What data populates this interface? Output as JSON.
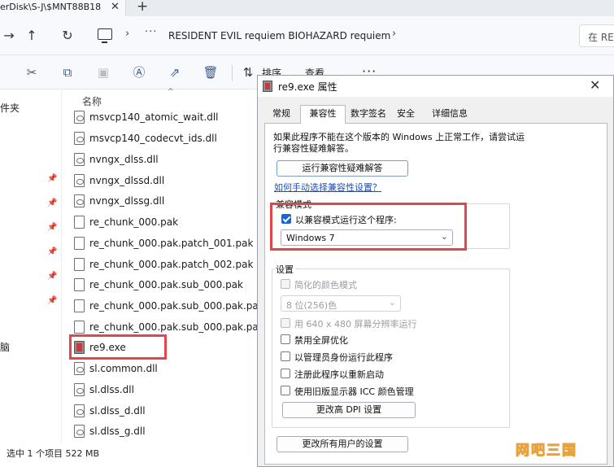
{
  "explorer": {
    "tab_title": "erDisk\\S-J\\$MNT88B18",
    "tab_close": "✕",
    "tab_new": "+",
    "breadcrumb_more": "···",
    "breadcrumb_folder": "RESIDENT EVIL requiem BIOHAZARD requiem",
    "search_placeholder": "在 RE",
    "toolbar": {
      "sort_label": "排序",
      "view_label": "查看",
      "more_label": "···"
    },
    "nav_items": [
      "件夹",
      "脑"
    ],
    "column_name": "名称",
    "files": [
      {
        "name": "msvcp140_atomic_wait.dll",
        "type": "dll"
      },
      {
        "name": "msvcp140_codecvt_ids.dll",
        "type": "dll"
      },
      {
        "name": "nvngx_dlss.dll",
        "type": "dll"
      },
      {
        "name": "nvngx_dlssd.dll",
        "type": "dll"
      },
      {
        "name": "nvngx_dlssg.dll",
        "type": "dll"
      },
      {
        "name": "re_chunk_000.pak",
        "type": "file"
      },
      {
        "name": "re_chunk_000.pak.patch_001.pak",
        "type": "file"
      },
      {
        "name": "re_chunk_000.pak.patch_002.pak",
        "type": "file"
      },
      {
        "name": "re_chunk_000.pak.sub_000.pak",
        "type": "file"
      },
      {
        "name": "re_chunk_000.pak.sub_000.pak.patch_",
        "type": "file"
      },
      {
        "name": "re_chunk_000.pak.sub_000.pak.patch_",
        "type": "file"
      },
      {
        "name": "re9.exe",
        "type": "exe"
      },
      {
        "name": "sl.common.dll",
        "type": "dll"
      },
      {
        "name": "sl.dlss.dll",
        "type": "dll"
      },
      {
        "name": "sl.dlss_d.dll",
        "type": "dll"
      },
      {
        "name": "sl.dlss_g.dll",
        "type": "dll"
      }
    ],
    "status": "选中 1 个项目  522 MB"
  },
  "dialog": {
    "title": "re9.exe 属性",
    "close": "✕",
    "tabs": [
      {
        "label": "常规",
        "active": false
      },
      {
        "label": "兼容性",
        "active": true
      },
      {
        "label": "数字签名",
        "active": false
      },
      {
        "label": "安全",
        "active": false
      },
      {
        "label": "详细信息",
        "active": false
      }
    ],
    "description": "如果此程序不能在这个版本的 Windows 上正常工作，请尝试运行兼容性疑难解答。",
    "run_troubleshooter": "运行兼容性疑难解答",
    "manual_link": "如何手动选择兼容性设置？",
    "compat_mode": {
      "group_title": "兼容模式",
      "checkbox_label": "以兼容模式运行这个程序:",
      "checked": true,
      "selected_os": "Windows 7"
    },
    "settings": {
      "group_title": "设置",
      "reduced_color_label": "简化的颜色模式",
      "color_depth": "8 位(256)色",
      "resolution_640_label": "用 640 x 480 屏幕分辨率运行",
      "disable_fullscreen_opt": "禁用全屏优化",
      "run_as_admin": "以管理员身份运行此程序",
      "register_restart": "注册此程序以重新启动",
      "legacy_icc": "使用旧版显示器 ICC 颜色管理",
      "high_dpi_button": "更改高 DPI 设置"
    },
    "all_users_button": "更改所有用户的设置"
  },
  "watermark": "网吧三国",
  "colors": {
    "highlight": "#e0474c",
    "accent": "#1a66d0",
    "link": "#1a4fb8"
  }
}
